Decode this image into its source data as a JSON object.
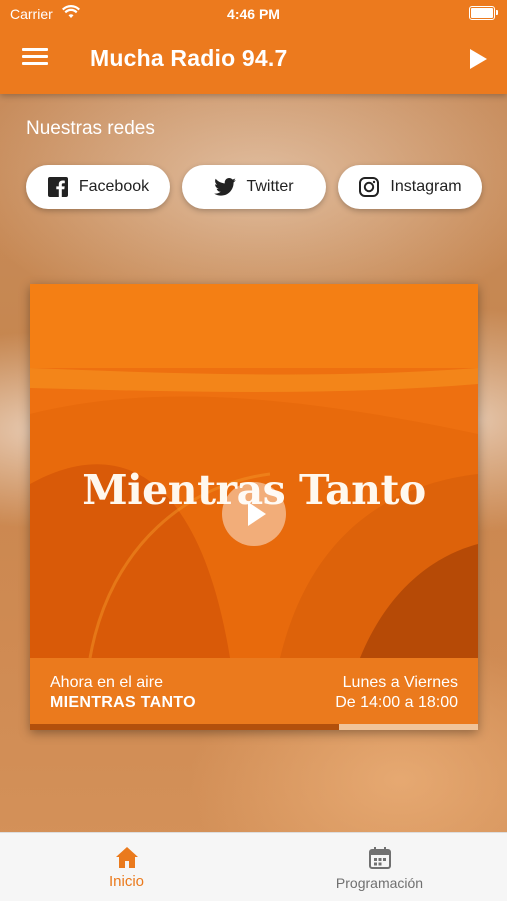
{
  "status_bar": {
    "carrier": "Carrier",
    "time": "4:46 PM"
  },
  "header": {
    "title": "Mucha Radio 94.7",
    "menu_icon": "hamburger-menu-icon",
    "play_icon": "play-icon"
  },
  "social": {
    "title": "Nuestras redes",
    "buttons": [
      {
        "label": "Facebook",
        "icon": "facebook-icon"
      },
      {
        "label": "Twitter",
        "icon": "twitter-icon"
      },
      {
        "label": "Instagram",
        "icon": "instagram-icon"
      }
    ]
  },
  "now_playing": {
    "artwork_title": "Mientras Tanto",
    "on_air_label": "Ahora en el aire",
    "show_name": "MIENTRAS TANTO",
    "days": "Lunes a Viernes",
    "hours": "De 14:00 a 18:00",
    "progress": 0.69
  },
  "tabs": [
    {
      "label": "Inicio",
      "icon": "home-icon",
      "active": true
    },
    {
      "label": "Programación",
      "icon": "calendar-icon",
      "active": false
    }
  ],
  "colors": {
    "accent": "#ec7a1e",
    "inactive_tab": "#707070",
    "tab_bar": "#f6f6f6"
  }
}
